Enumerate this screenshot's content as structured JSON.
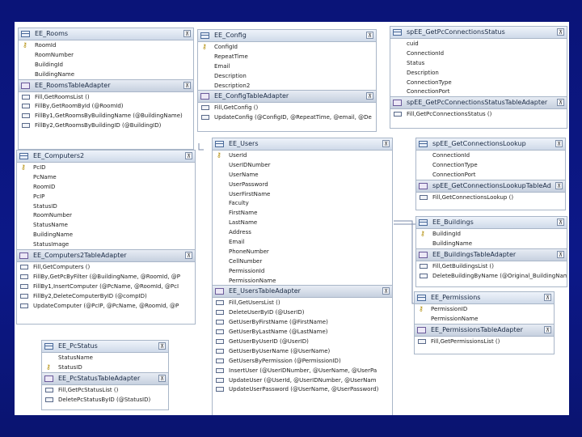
{
  "tables": {
    "rooms": {
      "title": "EE_Rooms",
      "collapse": "⊼",
      "fields": [
        {
          "label": "RoomId",
          "key": true
        },
        {
          "label": "RoomNumber"
        },
        {
          "label": "BuildingId"
        },
        {
          "label": "BuildingName"
        }
      ],
      "adapter": "EE_RoomsTableAdapter",
      "methods": [
        "Fill,GetRoomsList ()",
        "FillBy,GetRoomById (@RoomId)",
        "FillBy1,GetRoomsByBuildingName (@BuildingName)",
        "FillBy2,GetRoomsByBuildingID (@BuildingID)"
      ]
    },
    "config": {
      "title": "EE_Config",
      "collapse": "⊼",
      "fields": [
        {
          "label": "ConfigId",
          "key": true
        },
        {
          "label": "RepeatTime"
        },
        {
          "label": "Email"
        },
        {
          "label": "Description"
        },
        {
          "label": "Description2"
        }
      ],
      "adapter": "EE_ConfigTableAdapter",
      "methods": [
        "Fill,GetConfig ()",
        "UpdateConfig (@ConfigID, @RepeatTime, @email, @De"
      ]
    },
    "status": {
      "title": "spEE_GetPcConnectionsStatus",
      "collapse": "⊼",
      "fields": [
        {
          "label": "cuid"
        },
        {
          "label": "ConnectionId"
        },
        {
          "label": "Status"
        },
        {
          "label": "Description"
        },
        {
          "label": "ConnectionType"
        },
        {
          "label": "ConnectionPort"
        }
      ],
      "adapter": "spEE_GetPcConnectionsStatusTableAdapter",
      "methods": [
        "Fill,GetPcConnectionsStatus ()"
      ]
    },
    "computers": {
      "title": "EE_Computers2",
      "collapse": "⊼",
      "fields": [
        {
          "label": "PcID",
          "key": true
        },
        {
          "label": "PcName"
        },
        {
          "label": "RoomID"
        },
        {
          "label": "PcIP"
        },
        {
          "label": "StatusID"
        },
        {
          "label": "RoomNumber"
        },
        {
          "label": "StatusName"
        },
        {
          "label": "BuildingName"
        },
        {
          "label": "StatusImage"
        }
      ],
      "adapter": "EE_Computers2TableAdapter",
      "methods": [
        "Fill,GetComputers ()",
        "FillBy,GetPcByFilter (@BuildingName, @RoomId, @P",
        "FillBy1,InsertComputer (@PcName, @RoomId, @PcI",
        "FillBy2,DeleteComputerByID (@compID)",
        "UpdateComputer (@PcIP, @PcName, @RoomId, @P"
      ]
    },
    "users": {
      "title": "EE_Users",
      "collapse": "⊼",
      "fields": [
        {
          "label": "UserId",
          "key": true
        },
        {
          "label": "UserIDNumber"
        },
        {
          "label": "UserName"
        },
        {
          "label": "UserPassword"
        },
        {
          "label": "UserFirstName"
        },
        {
          "label": "Faculty"
        },
        {
          "label": "FirstName"
        },
        {
          "label": "LastName"
        },
        {
          "label": "Address"
        },
        {
          "label": "Email"
        },
        {
          "label": "PhoneNumber"
        },
        {
          "label": "CellNumber"
        },
        {
          "label": "PermissionId"
        },
        {
          "label": "PermissionName"
        }
      ],
      "adapter": "EE_UsersTableAdapter",
      "methods": [
        "Fill,GetUsersList ()",
        "DeleteUserByID (@UserID)",
        "GetUserByFirstName (@FirstName)",
        "GetUserByLastName (@LastName)",
        "GetUserByUserID (@UserID)",
        "GetUserByUserName (@UserName)",
        "GetUsersByPermission (@PermissionID)",
        "InsertUser (@UserIDNumber, @UserName, @UserPa",
        "UpdateUser (@UserId, @UserIDNumber, @UserNam",
        "UpdateUserPassword (@UserName, @UserPassword)"
      ]
    },
    "lookup": {
      "title": "spEE_GetConnectionsLookup",
      "collapse": "⊼",
      "fields": [
        {
          "label": "ConnectionId"
        },
        {
          "label": "ConnectionType"
        },
        {
          "label": "ConnectionPort"
        }
      ],
      "adapter": "spEE_GetConnectionsLookupTableAd",
      "methods": [
        "Fill,GetConnectionsLookup ()"
      ]
    },
    "buildings": {
      "title": "EE_Buildings",
      "collapse": "⊼",
      "fields": [
        {
          "label": "BuildingId",
          "key": true
        },
        {
          "label": "BuildingName"
        }
      ],
      "adapter": "EE_BuildingsTableAdapter",
      "methods": [
        "Fill,GetBuildingsList ()",
        "DeleteBuildingByName (@Original_BuildingName)"
      ]
    },
    "permissions": {
      "title": "EE_Permissions",
      "collapse": "⊼",
      "fields": [
        {
          "label": "PermissionID",
          "key": true
        },
        {
          "label": "PermissionName"
        }
      ],
      "adapter": "EE_PermissionsTableAdapter",
      "methods": [
        "Fill,GetPermissionsList ()"
      ]
    },
    "pcstatus": {
      "title": "EE_PcStatus",
      "collapse": "⊼",
      "fields": [
        {
          "label": "StatusName"
        },
        {
          "label": "StatusID",
          "key": true
        }
      ],
      "adapter": "EE_PcStatusTableAdapter",
      "methods": [
        "Fill,GetPcStatusList ()",
        "DeletePcStatusByID (@StatusID)"
      ]
    }
  }
}
